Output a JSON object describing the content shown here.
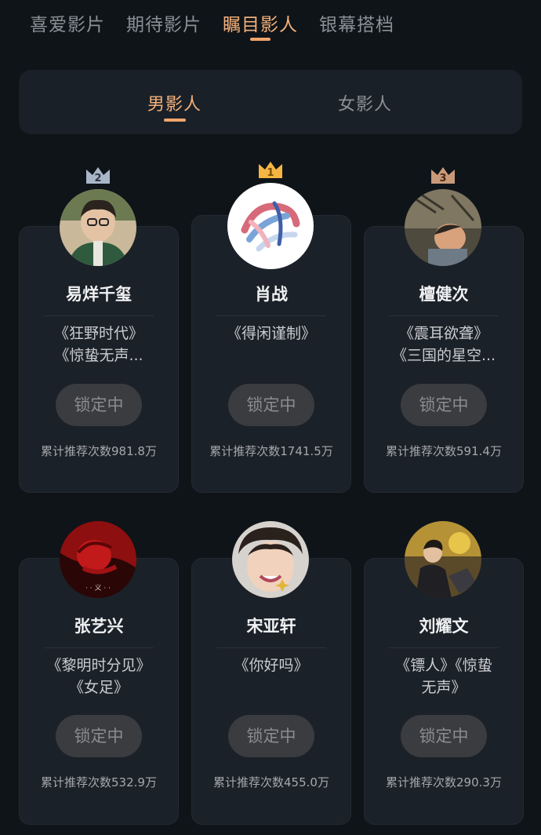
{
  "top_tabs": [
    "喜爱影片",
    "期待影片",
    "瞩目影人",
    "银幕搭档"
  ],
  "gender_tabs": [
    "男影人",
    "女影人"
  ],
  "ranks": [
    "2",
    "1",
    "3"
  ],
  "people": [
    {
      "name": "易烊千玺",
      "works": [
        "《狂野时代》",
        "《惊蛰无声..."
      ],
      "button": "锁定中",
      "count": "累计推荐次数981.8万"
    },
    {
      "name": "肖战",
      "works": [
        "《得闲谨制》"
      ],
      "button": "锁定中",
      "count": "累计推荐次数1741.5万"
    },
    {
      "name": "檀健次",
      "works": [
        "《震耳欲聋》",
        "《三国的星空..."
      ],
      "button": "锁定中",
      "count": "累计推荐次数591.4万"
    },
    {
      "name": "张艺兴",
      "works": [
        "《黎明时分见》",
        "《女足》"
      ],
      "button": "锁定中",
      "count": "累计推荐次数532.9万"
    },
    {
      "name": "宋亚轩",
      "works": [
        "《你好吗》"
      ],
      "button": "锁定中",
      "count": "累计推荐次数455.0万"
    },
    {
      "name": "刘耀文",
      "works": [
        "《镖人》《惊蛰",
        "无声》"
      ],
      "button": "锁定中",
      "count": "累计推荐次数290.3万"
    }
  ],
  "colors": {
    "accent": "#f0a56c",
    "background": "#0f1419",
    "card": "#1b2128",
    "gold": "#f5b642",
    "silver": "#a9b6c8",
    "bronze": "#c99a7a"
  }
}
